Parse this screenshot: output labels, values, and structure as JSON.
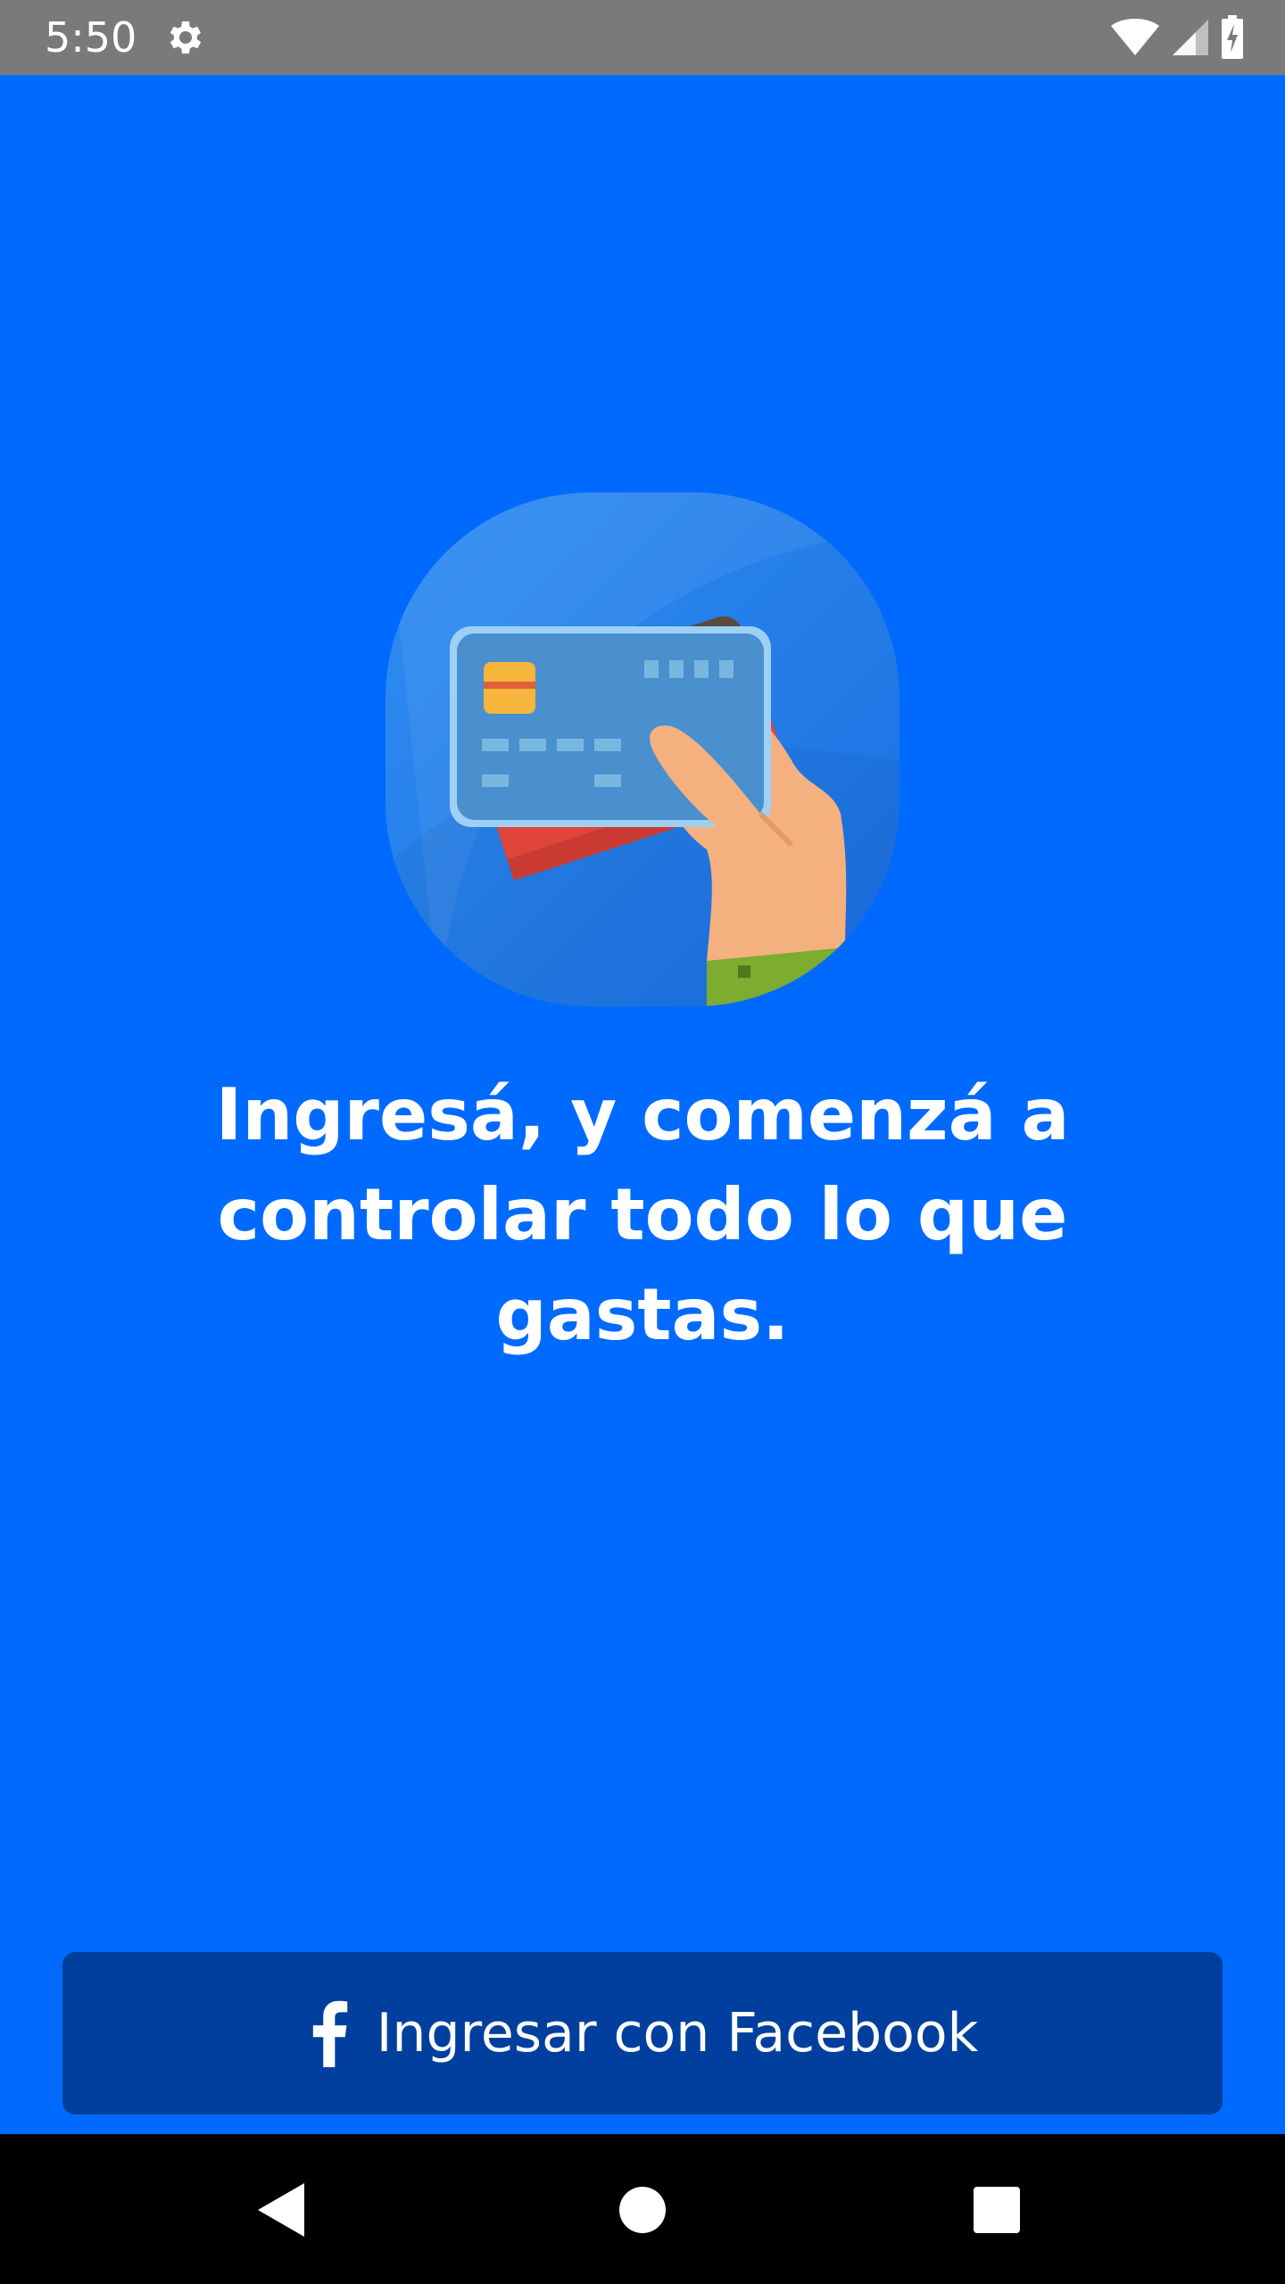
{
  "status_bar": {
    "time": "5:50",
    "icons": [
      "gear-icon",
      "wifi-icon",
      "signal-icon",
      "battery-charging-icon"
    ],
    "background": "#7a7a7a"
  },
  "main": {
    "background": "#006aff",
    "illustration": "credit-card-hand-icon",
    "headline": "Ingresá, y comenzá a controlar todo lo que gastas."
  },
  "login": {
    "facebook_button_label": "Ingresar con Facebook",
    "facebook_icon": "facebook-icon",
    "button_color": "#003f9e"
  },
  "nav_bar": {
    "buttons": [
      "back-icon",
      "home-icon",
      "recents-icon"
    ]
  }
}
